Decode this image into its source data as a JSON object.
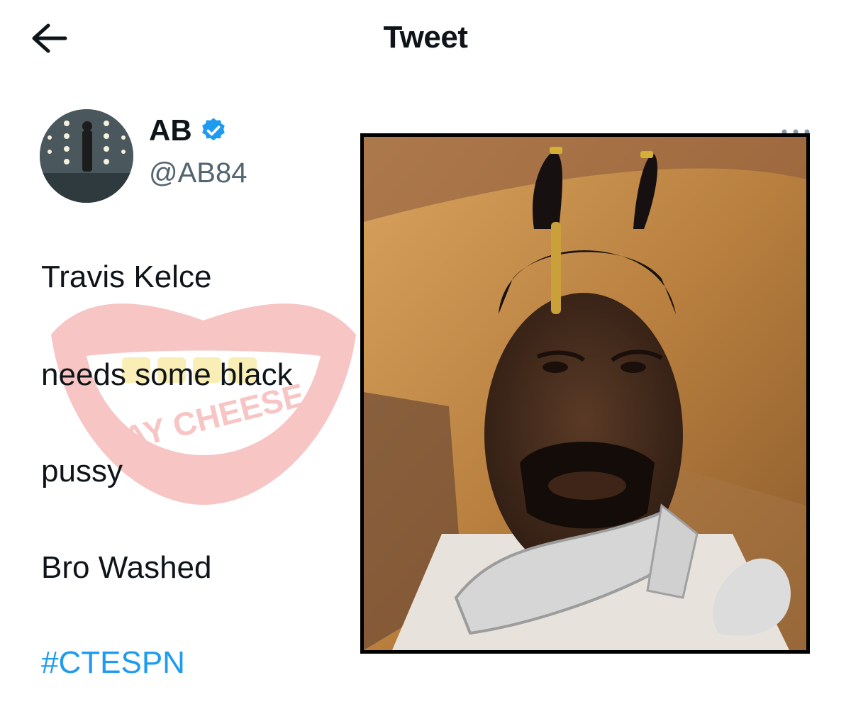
{
  "header": {
    "title": "Tweet"
  },
  "author": {
    "name": "AB",
    "handle": "@AB84",
    "verified": true
  },
  "tweet": {
    "lines": [
      "Travis Kelce",
      "needs some black",
      "pussy",
      "Bro Washed"
    ],
    "hashtag": "#CTESPN"
  },
  "watermark": {
    "text": "SAY CHEESE"
  },
  "colors": {
    "link": "#1d9bf0",
    "verified": "#1d9bf0",
    "secondary_text": "#536471"
  },
  "icons": {
    "back": "arrow-left-icon",
    "verified": "verified-badge-icon",
    "more": "more-dots-icon"
  }
}
